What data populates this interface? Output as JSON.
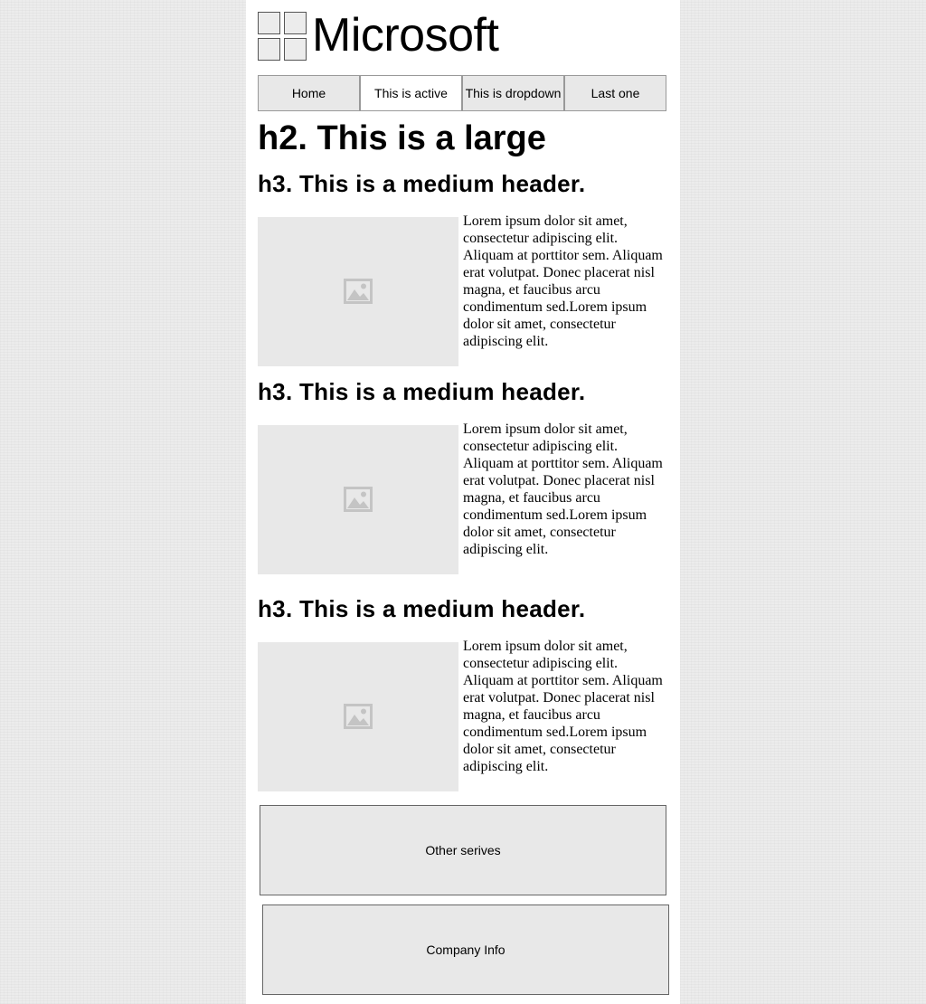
{
  "brand": {
    "name": "Microsoft",
    "logo_icon": "four-squares-icon"
  },
  "nav": {
    "items": [
      {
        "label": "Home",
        "active": false
      },
      {
        "label": "This is active",
        "active": true
      },
      {
        "label": "This is dropdown",
        "active": false
      },
      {
        "label": "Last one",
        "active": false
      }
    ]
  },
  "main": {
    "title": "h2. This is a large",
    "sections": [
      {
        "heading": "h3. This is a medium header.",
        "image_icon": "image-placeholder-icon",
        "text": "Lorem ipsum dolor sit amet, consectetur adipiscing elit. Aliquam at porttitor sem. Aliquam erat volutpat. Donec placerat nisl magna, et faucibus arcu condimentum sed.Lorem ipsum dolor sit amet, consectetur adipiscing elit."
      },
      {
        "heading": "h3. This is a medium header.",
        "image_icon": "image-placeholder-icon",
        "text": "Lorem ipsum dolor sit amet, consectetur adipiscing elit. Aliquam at porttitor sem. Aliquam erat volutpat. Donec placerat nisl magna, et faucibus arcu condimentum sed.Lorem ipsum dolor sit amet, consectetur adipiscing elit."
      },
      {
        "heading": "h3. This is a medium header.",
        "image_icon": "image-placeholder-icon",
        "text": "Lorem ipsum dolor sit amet, consectetur adipiscing elit. Aliquam at porttitor sem. Aliquam erat volutpat. Donec placerat nisl magna, et faucibus arcu condimentum sed.Lorem ipsum dolor sit amet, consectetur adipiscing elit."
      }
    ]
  },
  "footer": {
    "other_services": "Other serives",
    "company_info": "Company Info"
  },
  "colors": {
    "page_bg": "#ececec",
    "content_bg": "#ffffff",
    "placeholder_bg": "#e8e8e8",
    "placeholder_icon": "#c4c4c4"
  }
}
